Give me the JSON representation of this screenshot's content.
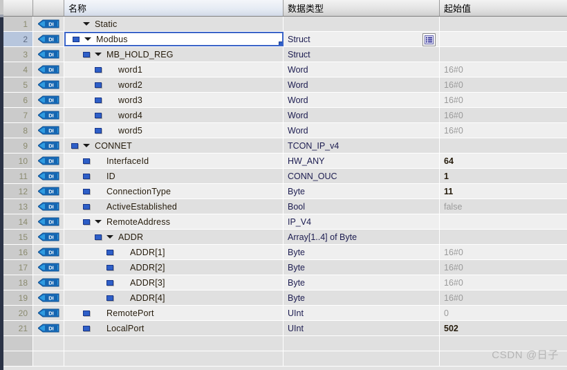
{
  "header": {
    "col_row_number": "",
    "col_icon": "",
    "col_name": "名称",
    "col_datatype": "数据类型",
    "col_start_value": "起始值"
  },
  "icons": {
    "di_tag": "di-tag-icon",
    "expand_triangle": "triangle-down-icon",
    "leaf_square": "blue-square-icon",
    "struct_detail": "struct-list-button-icon"
  },
  "colors": {
    "selection_border": "#3a64c8",
    "leaf_marker": "#2e5fc8",
    "default_value_text": "#9a9a9a",
    "modified_value_text": "#241a0a",
    "grid_band_dark": "#e0e0e0",
    "grid_band_light": "#efefef"
  },
  "rows": [
    {
      "num": "1",
      "indent": 0,
      "toggle": "triangle",
      "marker": "none",
      "name": "Static",
      "datatype": "",
      "value": "",
      "value_state": "none",
      "selected": false,
      "struct_button": false
    },
    {
      "num": "2",
      "indent": 0,
      "toggle": "triangle",
      "marker": "square",
      "name": "Modbus",
      "datatype": "Struct",
      "value": "",
      "value_state": "none",
      "selected": true,
      "struct_button": true
    },
    {
      "num": "3",
      "indent": 1,
      "toggle": "triangle",
      "marker": "square",
      "name": "MB_HOLD_REG",
      "datatype": "Struct",
      "value": "",
      "value_state": "none",
      "selected": false,
      "struct_button": false
    },
    {
      "num": "4",
      "indent": 2,
      "toggle": "none",
      "marker": "square",
      "name": "word1",
      "datatype": "Word",
      "value": "16#0",
      "value_state": "default",
      "selected": false,
      "struct_button": false
    },
    {
      "num": "5",
      "indent": 2,
      "toggle": "none",
      "marker": "square",
      "name": "word2",
      "datatype": "Word",
      "value": "16#0",
      "value_state": "default",
      "selected": false,
      "struct_button": false
    },
    {
      "num": "6",
      "indent": 2,
      "toggle": "none",
      "marker": "square",
      "name": "word3",
      "datatype": "Word",
      "value": "16#0",
      "value_state": "default",
      "selected": false,
      "struct_button": false
    },
    {
      "num": "7",
      "indent": 2,
      "toggle": "none",
      "marker": "square",
      "name": "word4",
      "datatype": "Word",
      "value": "16#0",
      "value_state": "default",
      "selected": false,
      "struct_button": false
    },
    {
      "num": "8",
      "indent": 2,
      "toggle": "none",
      "marker": "square",
      "name": "word5",
      "datatype": "Word",
      "value": "16#0",
      "value_state": "default",
      "selected": false,
      "struct_button": false
    },
    {
      "num": "9",
      "indent": 0,
      "toggle": "triangle",
      "marker": "square",
      "name": "CONNET",
      "datatype": "TCON_IP_v4",
      "value": "",
      "value_state": "none",
      "selected": false,
      "struct_button": false
    },
    {
      "num": "10",
      "indent": 1,
      "toggle": "none",
      "marker": "square",
      "name": "InterfaceId",
      "datatype": "HW_ANY",
      "value": "64",
      "value_state": "modified",
      "selected": false,
      "struct_button": false
    },
    {
      "num": "11",
      "indent": 1,
      "toggle": "none",
      "marker": "square",
      "name": "ID",
      "datatype": "CONN_OUC",
      "value": "1",
      "value_state": "modified",
      "selected": false,
      "struct_button": false
    },
    {
      "num": "12",
      "indent": 1,
      "toggle": "none",
      "marker": "square",
      "name": "ConnectionType",
      "datatype": "Byte",
      "value": "11",
      "value_state": "modified",
      "selected": false,
      "struct_button": false
    },
    {
      "num": "13",
      "indent": 1,
      "toggle": "none",
      "marker": "square",
      "name": "ActiveEstablished",
      "datatype": "Bool",
      "value": "false",
      "value_state": "default",
      "selected": false,
      "struct_button": false
    },
    {
      "num": "14",
      "indent": 1,
      "toggle": "triangle",
      "marker": "square",
      "name": "RemoteAddress",
      "datatype": "IP_V4",
      "value": "",
      "value_state": "none",
      "selected": false,
      "struct_button": false
    },
    {
      "num": "15",
      "indent": 2,
      "toggle": "triangle",
      "marker": "square",
      "name": "ADDR",
      "datatype": "Array[1..4] of Byte",
      "value": "",
      "value_state": "none",
      "selected": false,
      "struct_button": false
    },
    {
      "num": "16",
      "indent": 3,
      "toggle": "none",
      "marker": "square",
      "name": "ADDR[1]",
      "datatype": "Byte",
      "value": "16#0",
      "value_state": "default",
      "selected": false,
      "struct_button": false
    },
    {
      "num": "17",
      "indent": 3,
      "toggle": "none",
      "marker": "square",
      "name": "ADDR[2]",
      "datatype": "Byte",
      "value": "16#0",
      "value_state": "default",
      "selected": false,
      "struct_button": false
    },
    {
      "num": "18",
      "indent": 3,
      "toggle": "none",
      "marker": "square",
      "name": "ADDR[3]",
      "datatype": "Byte",
      "value": "16#0",
      "value_state": "default",
      "selected": false,
      "struct_button": false
    },
    {
      "num": "19",
      "indent": 3,
      "toggle": "none",
      "marker": "square",
      "name": "ADDR[4]",
      "datatype": "Byte",
      "value": "16#0",
      "value_state": "default",
      "selected": false,
      "struct_button": false
    },
    {
      "num": "20",
      "indent": 1,
      "toggle": "none",
      "marker": "square",
      "name": "RemotePort",
      "datatype": "UInt",
      "value": "0",
      "value_state": "default",
      "selected": false,
      "struct_button": false
    },
    {
      "num": "21",
      "indent": 1,
      "toggle": "none",
      "marker": "square",
      "name": "LocalPort",
      "datatype": "UInt",
      "value": "502",
      "value_state": "modified",
      "selected": false,
      "struct_button": false
    }
  ],
  "empty_row_count": 2,
  "watermark": "CSDN @日子"
}
